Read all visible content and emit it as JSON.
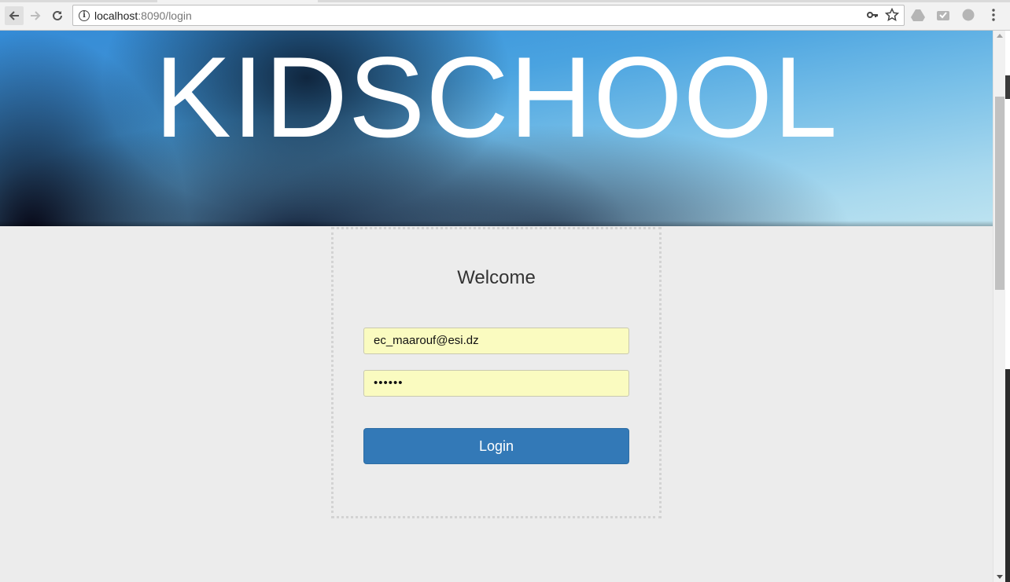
{
  "browser": {
    "url_host": "localhost",
    "url_rest": ":8090/login",
    "icons": [
      "back-arrow-icon",
      "forward-arrow-icon",
      "reload-icon",
      "site-info-icon",
      "key-icon",
      "star-icon",
      "drive-icon",
      "inbox-icon",
      "extension-icon",
      "menu-kebab-icon"
    ]
  },
  "hero": {
    "brand": "KIDSCHOOL"
  },
  "login": {
    "heading": "Welcome",
    "email_value": "ec_maarouf@esi.dz",
    "password_value": "••••••",
    "submit_label": "Login"
  },
  "colors": {
    "button": "#3379b7",
    "autofill_field": "#fafbc0",
    "page_background": "#ececec"
  }
}
